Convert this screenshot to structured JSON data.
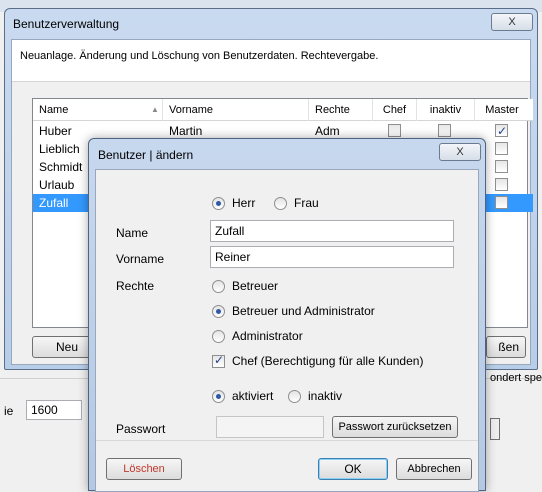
{
  "main_window": {
    "title": "Benutzerverwaltung",
    "close_glyph": "X",
    "header_text": "Neuanlage. Änderung und Löschung von Benutzerdaten. Rechtevergabe.",
    "columns": [
      "Name",
      "Vorname",
      "Rechte",
      "Chef",
      "inaktiv",
      "Master"
    ],
    "sort_glyph": "▲",
    "rows": [
      {
        "name": "Huber",
        "vorname": "Martin",
        "rechte": "Adm",
        "chef": false,
        "inaktiv": false,
        "master": true,
        "selected": false
      },
      {
        "name": "Lieblich",
        "selected": false
      },
      {
        "name": "Schmidt",
        "selected": false
      },
      {
        "name": "Urlaub",
        "selected": false
      },
      {
        "name": "Zufall",
        "selected": true
      }
    ],
    "new_button": "Neu",
    "close_button_partial": "ßen",
    "lower_label": "ie",
    "lower_value": "1600",
    "lower_right_text": "ondert spei"
  },
  "dialog": {
    "title": "Benutzer | ändern",
    "close_glyph": "X",
    "salutation": {
      "herr": "Herr",
      "frau": "Frau",
      "selected": "herr"
    },
    "name_label": "Name",
    "name_value": "Zufall",
    "vorname_label": "Vorname",
    "vorname_value": "Reiner",
    "rechte_label": "Rechte",
    "rechte_options": [
      "Betreuer",
      "Betreuer und Administrator",
      "Administrator"
    ],
    "rechte_selected": 1,
    "chef_label": "Chef (Berechtigung für alle Kunden)",
    "chef_checked": true,
    "aktiviert_label": "aktiviert",
    "inaktiv_label": "inaktiv",
    "status_selected": "aktiviert",
    "passwort_label": "Passwort",
    "reset_button": "Passwort zurücksetzen",
    "delete_button": "Löschen",
    "ok_button": "OK",
    "cancel_button": "Abbrechen",
    "delete_color": "#c0392b"
  }
}
